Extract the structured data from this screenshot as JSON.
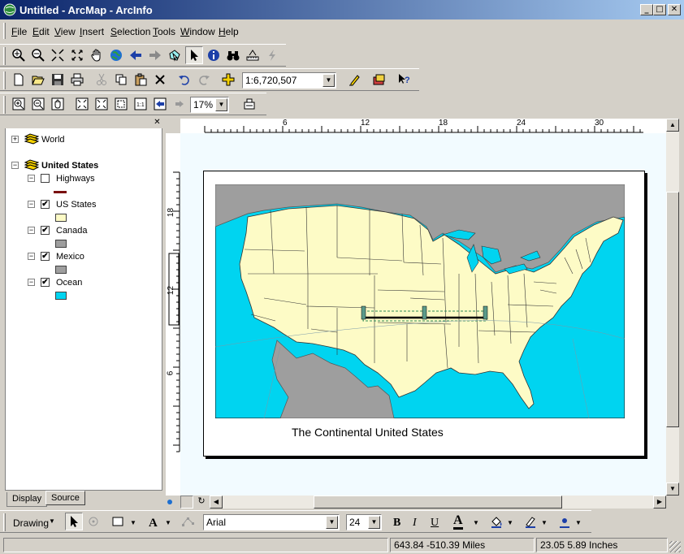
{
  "window": {
    "title": "Untitled - ArcMap - ArcInfo",
    "minimize": "_",
    "maximize": "□",
    "close": "✕"
  },
  "menu": [
    "File",
    "Edit",
    "View",
    "Insert",
    "Selection",
    "Tools",
    "Window",
    "Help"
  ],
  "standard_toolbar": {
    "scale": "1:6,720,507"
  },
  "layout_toolbar": {
    "zoom": "17%"
  },
  "toc": {
    "frames": [
      {
        "name": "World"
      },
      {
        "name": "United States"
      }
    ],
    "layers": [
      {
        "name": "Highways",
        "checked": "",
        "color": "#7a1010"
      },
      {
        "name": "US States",
        "checked": "✔",
        "color": "#fdfbc6"
      },
      {
        "name": "Canada",
        "checked": "✔",
        "color": "#9e9e9e"
      },
      {
        "name": "Mexico",
        "checked": "✔",
        "color": "#9e9e9e"
      },
      {
        "name": "Ocean",
        "checked": "✔",
        "color": "#00d4f0"
      }
    ],
    "tabs": [
      "Display",
      "Source"
    ]
  },
  "rulers": {
    "horizontal": [
      "6",
      "12",
      "18",
      "24",
      "30"
    ],
    "vertical": [
      "18",
      "12",
      "6"
    ]
  },
  "map": {
    "caption": "The Continental United States"
  },
  "drawing_toolbar": {
    "drawing_label": "Drawing",
    "font": "Arial",
    "size": "24",
    "bold": "B",
    "italic": "I",
    "underline": "U",
    "font_color_letter": "A"
  },
  "status": {
    "coords": "643.84  -510.39 Miles",
    "page_coords": "23.05  5.89 Inches"
  },
  "colors": {
    "ocean": "#00d4f0",
    "land": "#fdfbc6",
    "neighbors": "#9e9e9e"
  }
}
